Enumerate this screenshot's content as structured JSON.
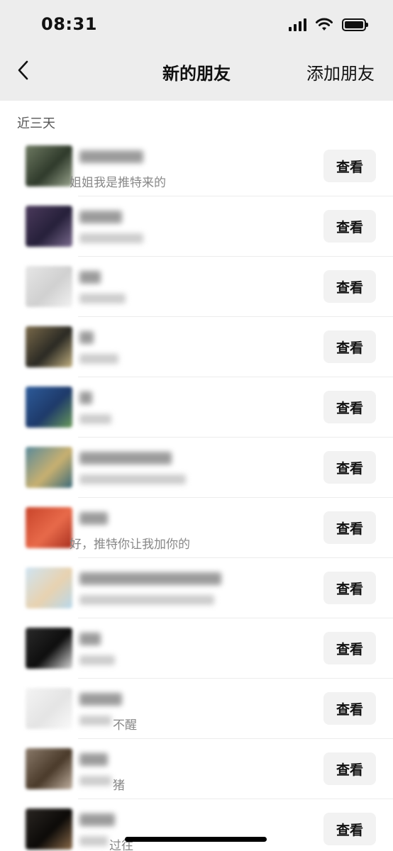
{
  "status": {
    "time": "08:31"
  },
  "nav": {
    "title": "新的朋友",
    "action": "添加朋友"
  },
  "section": {
    "header": "近三天"
  },
  "requests": [
    {
      "avatar_colors": [
        "#6e7a62",
        "#2f3a2b",
        "#9aa58e"
      ],
      "message": "姐姐我是推特来的",
      "button": "查看"
    },
    {
      "avatar_colors": [
        "#4b3a5c",
        "#26203a",
        "#7a6a8e"
      ],
      "message": "",
      "button": "查看"
    },
    {
      "avatar_colors": [
        "#e6e6e6",
        "#d0d0d0",
        "#f2f2f2"
      ],
      "message": "",
      "button": "查看"
    },
    {
      "avatar_colors": [
        "#7a6a4a",
        "#2b2a24",
        "#c2b080"
      ],
      "message": "",
      "button": "查看"
    },
    {
      "avatar_colors": [
        "#2d5b9a",
        "#1e3a6a",
        "#6a9a5a"
      ],
      "message": "",
      "button": "查看"
    },
    {
      "avatar_colors": [
        "#5a8a9a",
        "#c8b070",
        "#3a6a7a"
      ],
      "message": "",
      "button": "查看"
    },
    {
      "avatar_colors": [
        "#c8442a",
        "#e86a4a",
        "#a83020"
      ],
      "message": "好，推特你让我加你的",
      "button": "查看"
    },
    {
      "avatar_colors": [
        "#cfe4f2",
        "#e8d2b0",
        "#b8d8ec"
      ],
      "message": "",
      "button": "查看"
    },
    {
      "avatar_colors": [
        "#2a2a2a",
        "#0e0e0e",
        "#d8d8d8"
      ],
      "message": "",
      "button": "查看"
    },
    {
      "avatar_colors": [
        "#f4f4f4",
        "#e4e4e4",
        "#fafafa"
      ],
      "message": "不醒",
      "button": "查看"
    },
    {
      "avatar_colors": [
        "#8a7a6a",
        "#4a3a2a",
        "#c0b0a0"
      ],
      "message": "猪",
      "button": "查看"
    },
    {
      "avatar_colors": [
        "#2a2622",
        "#0c0a08",
        "#8a6a4a"
      ],
      "message": "过往",
      "button": "查看"
    }
  ]
}
